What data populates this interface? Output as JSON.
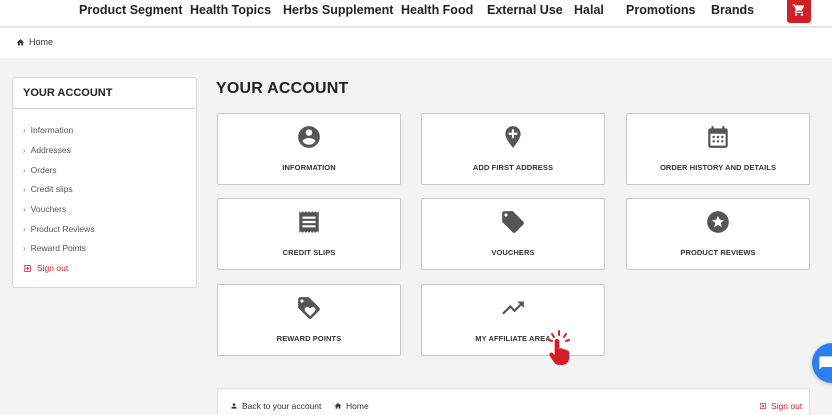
{
  "nav": {
    "items": [
      "Product Segment",
      "Health Topics",
      "Herbs Supplement",
      "Health Food",
      "External Use",
      "Halal",
      "Promotions",
      "Brands"
    ]
  },
  "breadcrumb": {
    "home": "Home"
  },
  "sidebar": {
    "title": "YOUR ACCOUNT",
    "items": [
      "Information",
      "Addresses",
      "Orders",
      "Credit slips",
      "Vouchers",
      "Product Reviews",
      "Reward Points"
    ],
    "signout": "Sign out"
  },
  "main": {
    "title": "YOUR ACCOUNT",
    "cards": [
      {
        "label": "INFORMATION",
        "icon": "account-circle-icon"
      },
      {
        "label": "ADD FIRST ADDRESS",
        "icon": "add-location-icon"
      },
      {
        "label": "ORDER HISTORY AND DETAILS",
        "icon": "calendar-icon"
      },
      {
        "label": "CREDIT SLIPS",
        "icon": "receipt-icon"
      },
      {
        "label": "VOUCHERS",
        "icon": "tag-icon"
      },
      {
        "label": "PRODUCT REVIEWS",
        "icon": "star-circle-icon"
      },
      {
        "label": "REWARD POINTS",
        "icon": "loyalty-icon"
      },
      {
        "label": "MY AFFILIATE AREA",
        "icon": "trending-up-icon"
      }
    ]
  },
  "footer": {
    "back": "Back to your account",
    "home": "Home",
    "signout": "Sign out"
  },
  "colors": {
    "accent": "#d11e27",
    "icon": "#555555",
    "chat": "#2d7ff0"
  }
}
